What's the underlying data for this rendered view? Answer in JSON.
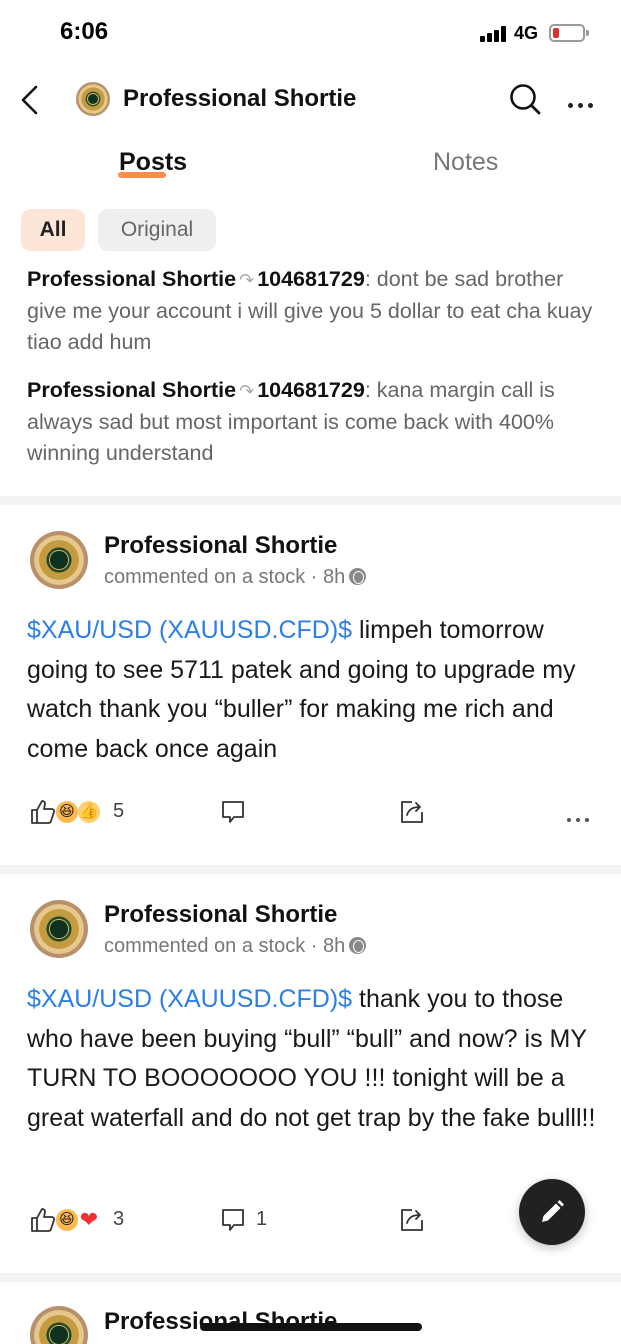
{
  "status_bar": {
    "time": "6:06",
    "network": "4G"
  },
  "header": {
    "title": "Professional Shortie"
  },
  "tabs": [
    {
      "label": "Posts",
      "active": true
    },
    {
      "label": "Notes",
      "active": false
    }
  ],
  "filters": [
    {
      "label": "All",
      "active": true
    },
    {
      "label": "Original",
      "active": false
    }
  ],
  "replies": [
    {
      "author": "Professional Shortie",
      "target": "104681729",
      "text": ": dont be sad brother give me your account i will give you 5 dollar to eat cha kuay tiao add hum"
    },
    {
      "author": "Professional Shortie",
      "target": "104681729",
      "text": ": kana margin call is always sad but most important is come back with 400% winning understand"
    }
  ],
  "posts": [
    {
      "author": "Professional Shortie",
      "meta": "commented on a stock · 8h",
      "ticker": "$XAU/USD (XAUUSD.CFD)$",
      "text": " limpeh tomorrow going to see 5711 patek and going to upgrade my watch thank you “buller” for making me rich and come back once again",
      "likes": "5",
      "comments": ""
    },
    {
      "author": "Professional Shortie",
      "meta": "commented on a stock · 8h",
      "ticker": "$XAU/USD (XAUUSD.CFD)$",
      "text": " thank you to those who have been buying “bull” “bull” and now? is MY TURN TO BOOOOOOO YOU !!! tonight will be a great waterfall and do not get trap by the fake bulll!!",
      "likes": "3",
      "comments": "1"
    },
    {
      "author": "Professional Shortie"
    }
  ],
  "colors": {
    "accent": "#ff7a2e",
    "ticker": "#2b7fe6",
    "fab": "#1f2123"
  },
  "icons": [
    "back-icon",
    "search-icon",
    "more-icon",
    "like-icon",
    "comment-icon",
    "share-icon",
    "globe-icon",
    "edit-icon"
  ]
}
